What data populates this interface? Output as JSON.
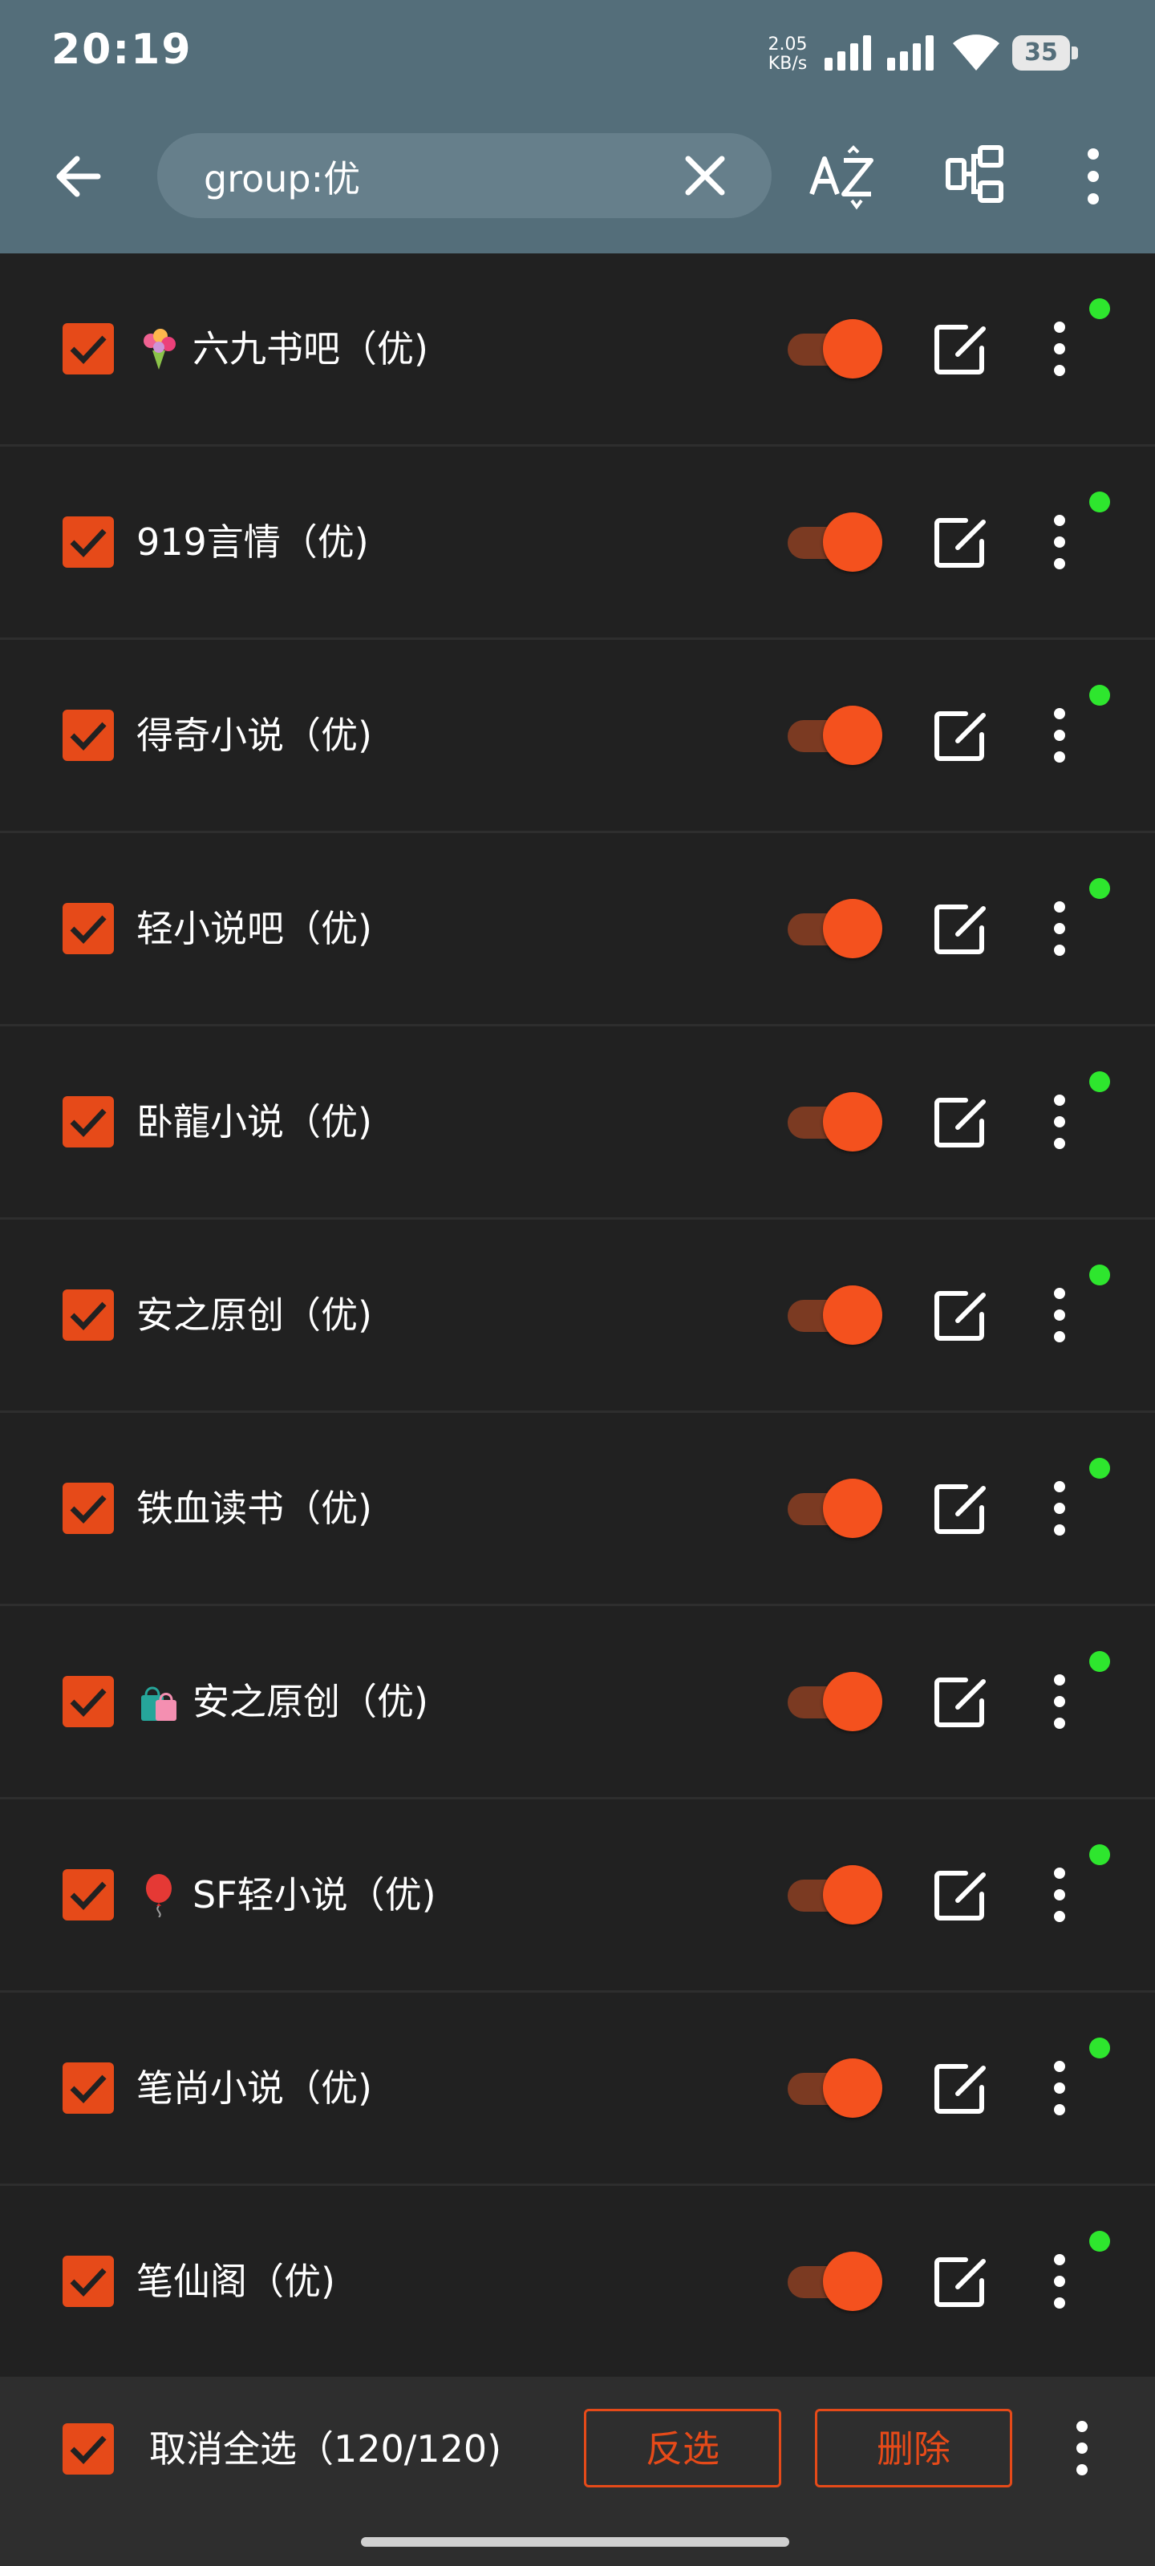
{
  "status_bar": {
    "time": "20:19",
    "net_speed_value": "2.05",
    "net_speed_unit": "KB/s",
    "battery_level": "35"
  },
  "toolbar": {
    "search_value": "group:优",
    "icons": [
      "back-arrow-icon",
      "clear-icon",
      "sort-az-icon",
      "group-icon",
      "more-vert-icon"
    ]
  },
  "sources": [
    {
      "emoji": "bouquet",
      "name": "六九书吧（优)",
      "checked": true,
      "enabled": true
    },
    {
      "emoji": "",
      "name": "919言情（优)",
      "checked": true,
      "enabled": true
    },
    {
      "emoji": "",
      "name": "得奇小说（优)",
      "checked": true,
      "enabled": true
    },
    {
      "emoji": "",
      "name": "轻小说吧（优)",
      "checked": true,
      "enabled": true
    },
    {
      "emoji": "",
      "name": "卧龍小说（优)",
      "checked": true,
      "enabled": true
    },
    {
      "emoji": "",
      "name": "安之原创（优)",
      "checked": true,
      "enabled": true
    },
    {
      "emoji": "",
      "name": "铁血读书（优)",
      "checked": true,
      "enabled": true
    },
    {
      "emoji": "shopping-bags",
      "name": "安之原创（优)",
      "checked": true,
      "enabled": true
    },
    {
      "emoji": "balloon",
      "name": "SF轻小说（优)",
      "checked": true,
      "enabled": true
    },
    {
      "emoji": "",
      "name": "笔尚小说（优)",
      "checked": true,
      "enabled": true
    },
    {
      "emoji": "",
      "name": "笔仙阁（优)",
      "checked": true,
      "enabled": true
    }
  ],
  "bottom_bar": {
    "select_all_label": "取消全选（120/120)",
    "invert_label": "反选",
    "delete_label": "删除"
  },
  "colors": {
    "toolbar": "#546e7a",
    "background": "#212121",
    "accent": "#e64a19",
    "status_dot": "#2ee62e"
  }
}
